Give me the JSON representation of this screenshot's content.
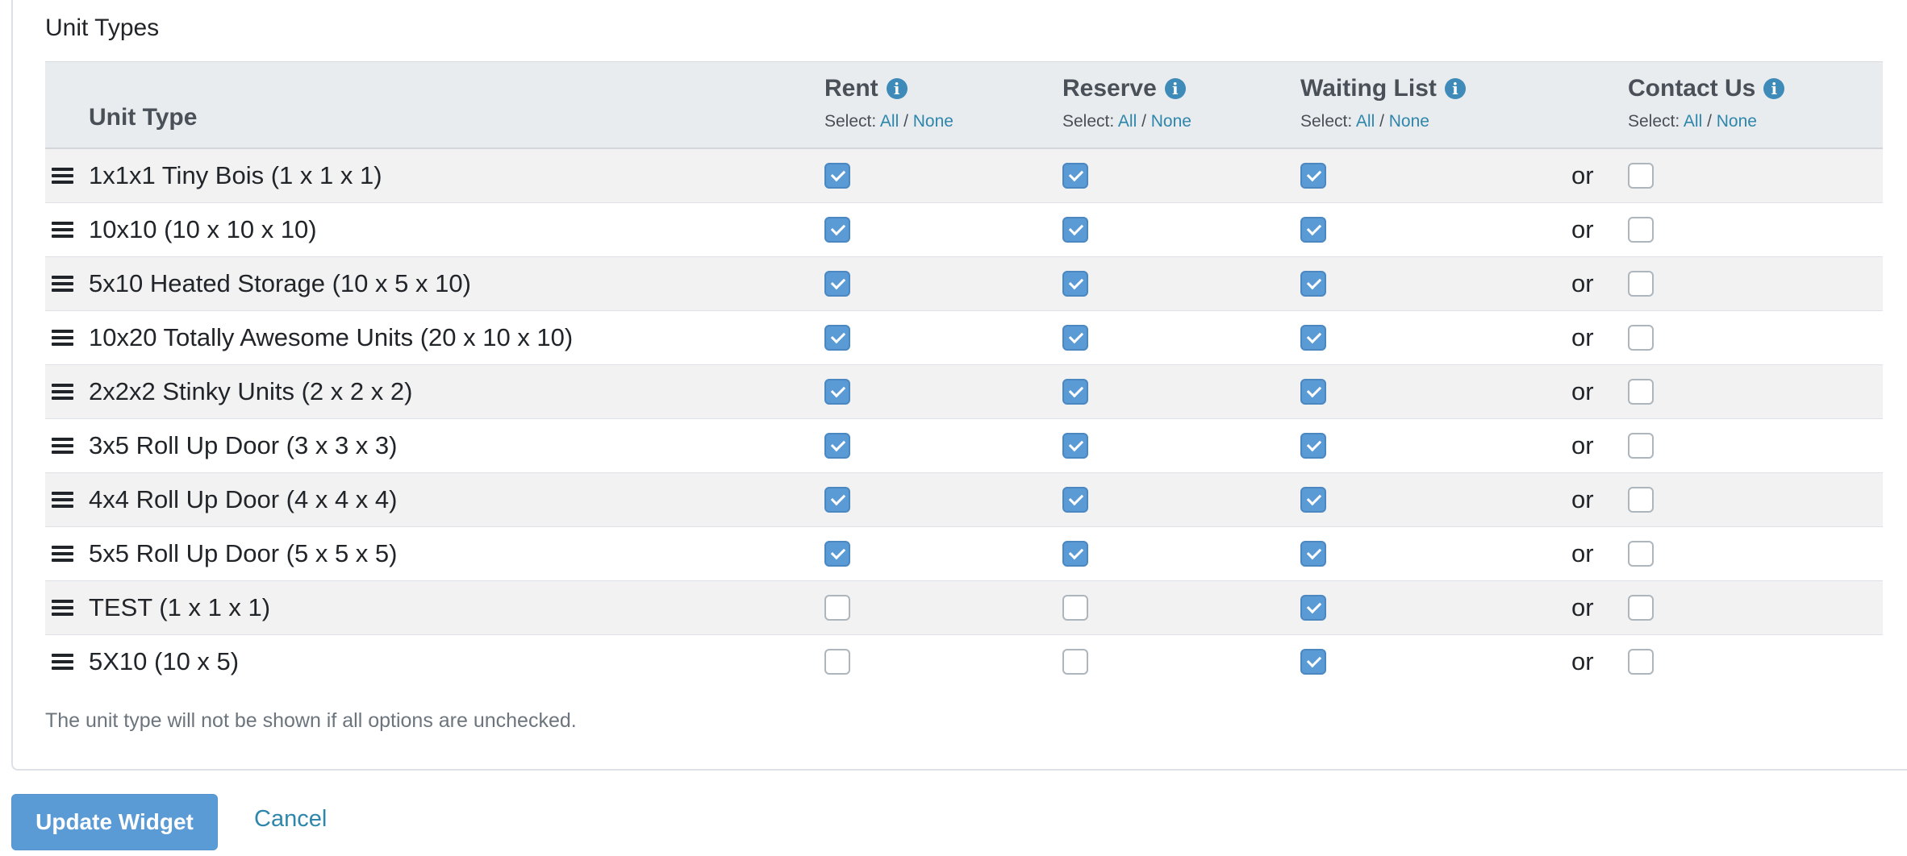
{
  "section_title": "Unit Types",
  "table": {
    "unit_type_header": "Unit Type",
    "select_label": "Select:",
    "select_all": "All",
    "select_none": "None",
    "separator": "/",
    "info_icon": "info-circle-icon",
    "columns": [
      {
        "key": "rent",
        "title": "Rent"
      },
      {
        "key": "reserve",
        "title": "Reserve"
      },
      {
        "key": "waiting_list",
        "title": "Waiting List"
      },
      {
        "key": "contact_us",
        "title": "Contact Us"
      }
    ],
    "or_label": "or",
    "drag_icon": "bars-drag-handle-icon",
    "rows": [
      {
        "name": "1x1x1 Tiny Bois (1 x 1 x 1)",
        "rent": true,
        "reserve": true,
        "waiting_list": true,
        "contact_us": false
      },
      {
        "name": "10x10 (10 x 10 x 10)",
        "rent": true,
        "reserve": true,
        "waiting_list": true,
        "contact_us": false
      },
      {
        "name": "5x10 Heated Storage (10 x 5 x 10)",
        "rent": true,
        "reserve": true,
        "waiting_list": true,
        "contact_us": false
      },
      {
        "name": "10x20 Totally Awesome Units (20 x 10 x 10)",
        "rent": true,
        "reserve": true,
        "waiting_list": true,
        "contact_us": false
      },
      {
        "name": "2x2x2 Stinky Units (2 x 2 x 2)",
        "rent": true,
        "reserve": true,
        "waiting_list": true,
        "contact_us": false
      },
      {
        "name": "3x5 Roll Up Door (3 x 3 x 3)",
        "rent": true,
        "reserve": true,
        "waiting_list": true,
        "contact_us": false
      },
      {
        "name": "4x4 Roll Up Door (4 x 4 x 4)",
        "rent": true,
        "reserve": true,
        "waiting_list": true,
        "contact_us": false
      },
      {
        "name": "5x5 Roll Up Door (5 x 5 x 5)",
        "rent": true,
        "reserve": true,
        "waiting_list": true,
        "contact_us": false
      },
      {
        "name": "TEST (1 x 1 x 1)",
        "rent": false,
        "reserve": false,
        "waiting_list": true,
        "contact_us": false
      },
      {
        "name": "5X10 (10 x 5)",
        "rent": false,
        "reserve": false,
        "waiting_list": true,
        "contact_us": false
      }
    ]
  },
  "note": "The unit type will not be shown if all options are unchecked.",
  "buttons": {
    "update": "Update Widget",
    "cancel": "Cancel"
  },
  "colors": {
    "checkbox_checked": "#5b9bd5",
    "link": "#2e86ab",
    "header_bg": "#e9ecef",
    "row_stripe": "#f2f2f2"
  }
}
